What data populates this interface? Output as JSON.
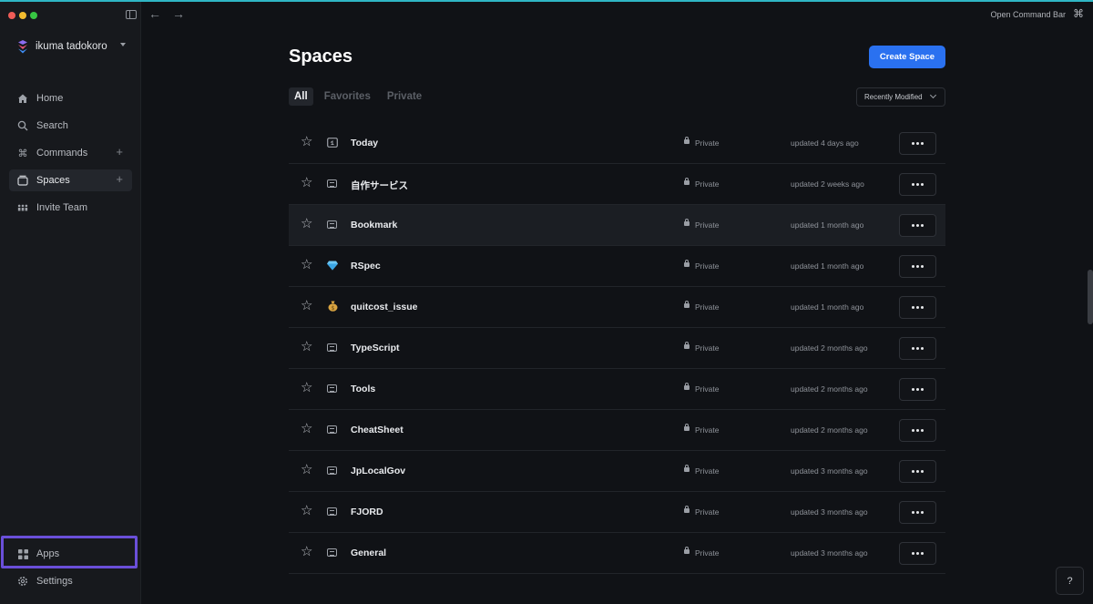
{
  "app": {
    "command_bar_label": "Open Command Bar"
  },
  "sidebar": {
    "user_name": "ikuma tadokoro",
    "items": [
      {
        "label": "Home",
        "icon": "home-icon"
      },
      {
        "label": "Search",
        "icon": "search-icon"
      },
      {
        "label": "Commands",
        "icon": "command-icon"
      },
      {
        "label": "Spaces",
        "icon": "spaces-icon"
      },
      {
        "label": "Invite Team",
        "icon": "team-icon"
      }
    ],
    "bottom": [
      {
        "label": "Apps",
        "icon": "apps-icon"
      },
      {
        "label": "Settings",
        "icon": "settings-icon"
      }
    ]
  },
  "main": {
    "title": "Spaces",
    "create_button": "Create Space",
    "tabs": [
      "All",
      "Favorites",
      "Private"
    ],
    "active_tab": "All",
    "sort_label": "Recently Modified",
    "spaces": [
      {
        "name": "Today",
        "visibility": "Private",
        "updated": "updated 4 days ago",
        "icon": "today-icon"
      },
      {
        "name": "自作サービス",
        "visibility": "Private",
        "updated": "updated 2 weeks ago",
        "icon": "space-icon"
      },
      {
        "name": "Bookmark",
        "visibility": "Private",
        "updated": "updated 1 month ago",
        "icon": "space-icon"
      },
      {
        "name": "RSpec",
        "visibility": "Private",
        "updated": "updated 1 month ago",
        "icon": "gem-icon"
      },
      {
        "name": "quitcost_issue",
        "visibility": "Private",
        "updated": "updated 1 month ago",
        "icon": "money-bag-icon"
      },
      {
        "name": "TypeScript",
        "visibility": "Private",
        "updated": "updated 2 months ago",
        "icon": "space-icon"
      },
      {
        "name": "Tools",
        "visibility": "Private",
        "updated": "updated 2 months ago",
        "icon": "space-icon"
      },
      {
        "name": "CheatSheet",
        "visibility": "Private",
        "updated": "updated 2 months ago",
        "icon": "space-icon"
      },
      {
        "name": "JpLocalGov",
        "visibility": "Private",
        "updated": "updated 3 months ago",
        "icon": "space-icon"
      },
      {
        "name": "FJORD",
        "visibility": "Private",
        "updated": "updated 3 months ago",
        "icon": "space-icon"
      },
      {
        "name": "General",
        "visibility": "Private",
        "updated": "updated 3 months ago",
        "icon": "space-icon"
      }
    ]
  },
  "help_label": "?"
}
